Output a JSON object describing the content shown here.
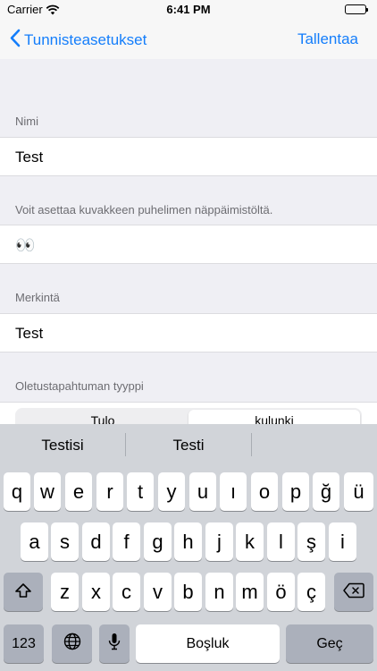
{
  "status_bar": {
    "carrier": "Carrier",
    "time": "6:41 PM"
  },
  "nav": {
    "back_label": "Tunnisteasetukset",
    "save_label": "Tallentaa"
  },
  "form": {
    "name_header": "Nimi",
    "name_value": "Test",
    "icon_header": "Voit asettaa kuvakkeen puhelimen näppäimistöltä.",
    "icon_value": "👀",
    "label_header": "Merkintä",
    "label_value": "Test",
    "event_type_header": "Oletustapahtuman tyyppi",
    "event_type_options": [
      "Tulo",
      "kulunki"
    ],
    "event_type_selected": "kulunki"
  },
  "keyboard": {
    "suggestions": [
      "Testisi",
      "Testi",
      ""
    ],
    "row1": [
      "q",
      "w",
      "e",
      "r",
      "t",
      "y",
      "u",
      "ı",
      "o",
      "p",
      "ğ",
      "ü"
    ],
    "row2": [
      "a",
      "s",
      "d",
      "f",
      "g",
      "h",
      "j",
      "k",
      "l",
      "ş",
      "i"
    ],
    "row3": [
      "z",
      "x",
      "c",
      "v",
      "b",
      "n",
      "m",
      "ö",
      "ç"
    ],
    "numbers_key": "123",
    "space_key": "Boşluk",
    "return_key": "Geç"
  },
  "colors": {
    "accent": "#147efb",
    "background": "#efeff4",
    "keyboard": "#d1d4d9"
  },
  "icons": [
    "wifi-icon",
    "battery-icon",
    "chevron-left-icon",
    "shift-icon",
    "backspace-icon",
    "globe-icon",
    "microphone-icon"
  ]
}
